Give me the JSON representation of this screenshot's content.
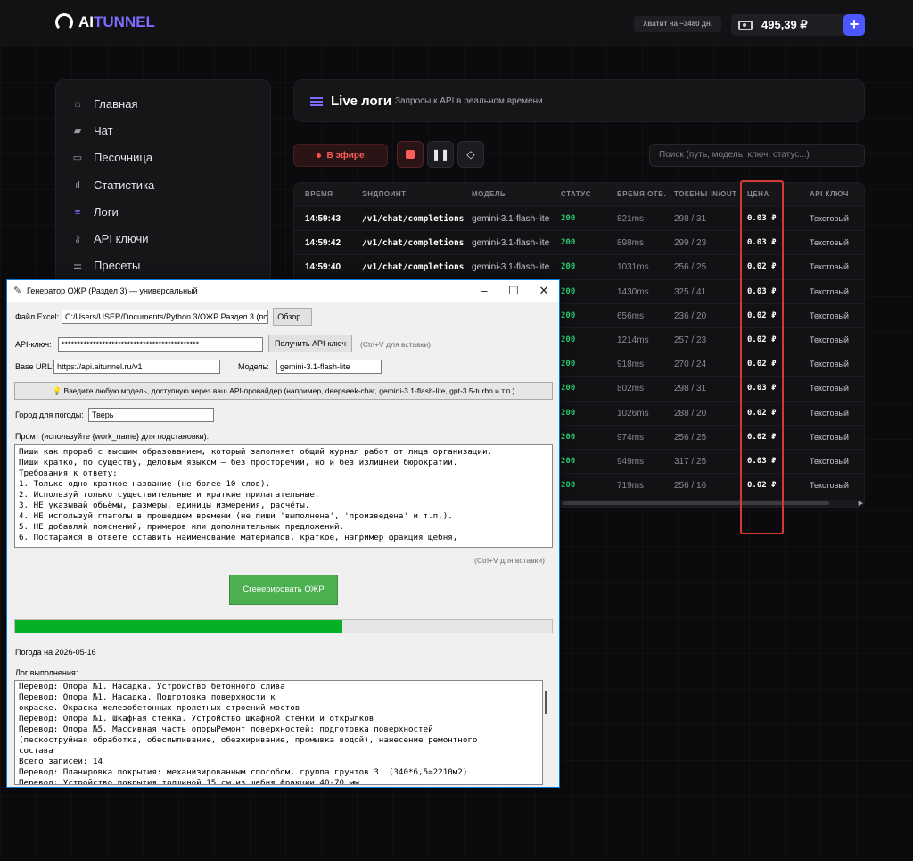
{
  "app": {
    "logo_ai": "AI",
    "logo_tunnel": "TUNNEL",
    "enough_text": "Хватит на ~3480 дн.",
    "balance": "495,39 ₽",
    "plus": "+"
  },
  "sidebar": {
    "items": [
      {
        "label": "Главная",
        "icon": "home-icon"
      },
      {
        "label": "Чат",
        "icon": "chat-icon"
      },
      {
        "label": "Песочница",
        "icon": "terminal-icon"
      },
      {
        "label": "Статистика",
        "icon": "bar-chart-icon"
      },
      {
        "label": "Логи",
        "icon": "list-icon"
      },
      {
        "label": "API ключи",
        "icon": "key-icon"
      },
      {
        "label": "Пресеты",
        "icon": "sliders-icon"
      }
    ]
  },
  "logs": {
    "title": "Live логи",
    "subtitle": "Запросы к API в реальном времени.",
    "onair": "В эфире",
    "search_placeholder": "Поиск (путь, модель, ключ, статус...)",
    "columns": [
      "ВРЕМЯ",
      "ЭНДПОИНТ",
      "МОДЕЛЬ",
      "СТАТУС",
      "ВРЕМЯ ОТВ.",
      "ТОКЕНЫ IN/OUT",
      "ЦЕНА",
      "API КЛЮЧ"
    ],
    "rows": [
      [
        "14:59:43",
        "/v1/chat/completions",
        "gemini-3.1-flash-lite",
        "200",
        "821ms",
        "298 / 31",
        "0.03 ₽",
        "Текстовый"
      ],
      [
        "14:59:42",
        "/v1/chat/completions",
        "gemini-3.1-flash-lite",
        "200",
        "898ms",
        "299 / 23",
        "0.03 ₽",
        "Текстовый"
      ],
      [
        "14:59:40",
        "/v1/chat/completions",
        "gemini-3.1-flash-lite",
        "200",
        "1031ms",
        "256 / 25",
        "0.02 ₽",
        "Текстовый"
      ],
      [
        "",
        "",
        "",
        "200",
        "1430ms",
        "325 / 41",
        "0.03 ₽",
        "Текстовый"
      ],
      [
        "",
        "",
        "",
        "200",
        "656ms",
        "236 / 20",
        "0.02 ₽",
        "Текстовый"
      ],
      [
        "",
        "",
        "",
        "200",
        "1214ms",
        "257 / 23",
        "0.02 ₽",
        "Текстовый"
      ],
      [
        "",
        "",
        "",
        "200",
        "918ms",
        "270 / 24",
        "0.02 ₽",
        "Текстовый"
      ],
      [
        "",
        "",
        "",
        "200",
        "802ms",
        "298 / 31",
        "0.03 ₽",
        "Текстовый"
      ],
      [
        "",
        "",
        "",
        "200",
        "1026ms",
        "288 / 20",
        "0.02 ₽",
        "Текстовый"
      ],
      [
        "",
        "",
        "",
        "200",
        "974ms",
        "256 / 25",
        "0.02 ₽",
        "Текстовый"
      ],
      [
        "",
        "",
        "",
        "200",
        "949ms",
        "317 / 25",
        "0.03 ₽",
        "Текстовый"
      ],
      [
        "",
        "",
        "",
        "200",
        "719ms",
        "256 / 16",
        "0.02 ₽",
        "Текстовый"
      ]
    ]
  },
  "window": {
    "title": "Генератор ОЖР (Раздел 3) — универсальный",
    "excel_label": "Файл Excel:",
    "excel_value": "C:/Users/USER/Documents/Python 3/ОЖР Раздел 3 (по ч",
    "browse": "Обзор...",
    "api_label": "API-ключ:",
    "api_value": "********************************************",
    "get_key": "Получить API-ключ",
    "paste_hint": "(Ctrl+V для вставки)",
    "base_label": "Base URL:",
    "base_value": "https://api.aitunnel.ru/v1",
    "model_label": "Модель:",
    "model_value": "gemini-3.1-flash-lite",
    "info": "💡 Введите любую модель, доступную через ваш API-провайдер (например, deepseek-chat, gemini-3.1-flash-lite, gpt-3.5-turbo и т.п.)",
    "city_label": "Город для погоды:",
    "city_value": "Тверь",
    "prompt_label": "Промт (используйте {work_name} для подстановки):",
    "prompt_lines": [
      "Пиши как прораб с высшим образованием, который заполняет общий журнал работ от лица организации.",
      "Пиши кратко, по существу, деловым языком – без просторечий, но и без излишней бюрократии.",
      "Требования к ответу:",
      "1. Только одно краткое название (не более 10 слов).",
      "2. Используй только существительные и краткие прилагательные.",
      "3. НЕ указывай объёмы, размеры, единицы измерения, расчёты.",
      "4. НЕ используй глаголы в прошедшем времени (не пиши 'выполнена', 'произведена' и т.п.).",
      "5. НЕ добавляй пояснений, примеров или дополнительных предложений.",
      "6. Постарайся в ответе оставить наименование материалов, краткое, например фракция щебня,"
    ],
    "paste_hint2": "(Ctrl+V для вставки)",
    "generate": "Сгенерировать ОЖР",
    "progress": 0.61,
    "weather": "Погода на 2026-05-16",
    "log_label": "Лог выполнения:",
    "log_lines": [
      "Перевод: Опора №1. Насадка. Устройство бетонного слива",
      "Перевод: Опора №1. Насадка. Подготовка поверхности к",
      "окраске. Окраска железобетонных пролетных строений мостов",
      "Перевод: Опора №1. Шкафная стенка. Устройство шкафной стенки и открылков",
      "Перевод: Опора №5. Массивная часть опорыРемонт поверхностей: подготовка поверхностей",
      "(пескоструйная обработка, обеспыливание, обезжиривание, промывка водой), нанесение ремонтного",
      "состава",
      "Всего записей: 14",
      "Перевод: Планировка покрытия: механизированным способом, группа грунтов 3  (340*6,5=2210м2)",
      "Перевод: Устройство покрытия толщиной 15 см из щебня фракции 40-70 мм"
    ]
  }
}
